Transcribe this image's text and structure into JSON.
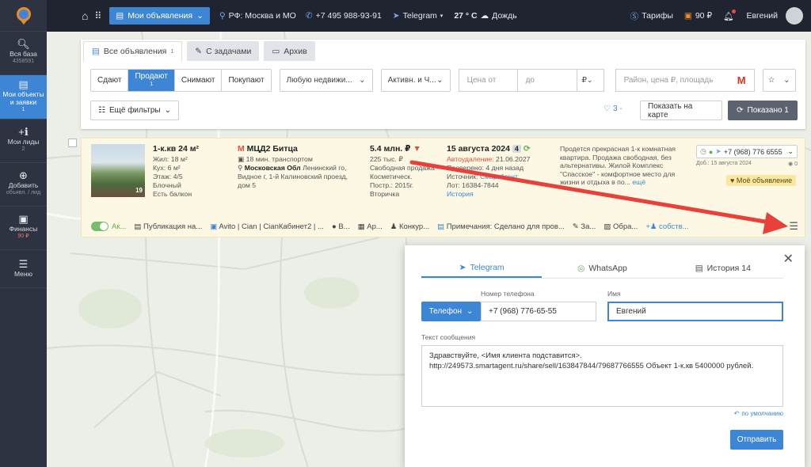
{
  "sidebar": {
    "items": [
      {
        "label": "Вся база",
        "sub": "4358591"
      },
      {
        "label": "Мои объекты и заявки",
        "sub": "1"
      },
      {
        "label": "Мои лиды",
        "sub": "2"
      },
      {
        "label": "Добавить",
        "sub": "объявл. / лид"
      },
      {
        "label": "Финансы",
        "sub": "90 ₽"
      },
      {
        "label": "Меню",
        "sub": ""
      }
    ]
  },
  "topbar": {
    "my_ads": "Мои объявления",
    "region": "РФ: Москва и МО",
    "phone": "+7 495 988-93-91",
    "telegram": "Telegram",
    "weather_temp": "27 ° C",
    "weather_text": "Дождь",
    "tariffs": "Тарифы",
    "balance": "90 ₽",
    "user": "Евгений"
  },
  "filters": {
    "tabs": [
      {
        "label": "Все объявления",
        "count": "1"
      },
      {
        "label": "С задачами",
        "count": ""
      },
      {
        "label": "Архив",
        "count": ""
      }
    ],
    "deal_types": [
      {
        "label": "Сдают",
        "count": ""
      },
      {
        "label": "Продают",
        "count": "1"
      },
      {
        "label": "Снимают",
        "count": ""
      },
      {
        "label": "Покупают",
        "count": ""
      }
    ],
    "property_select": "Любую недвижи...",
    "status_select": "Активн. и Ч...",
    "price_from_placeholder": "Цена от",
    "price_to_placeholder": "до",
    "currency": "₽",
    "search_placeholder": "Район, цена ₽, площадь",
    "more_filters": "Ещё фильтры",
    "favorites_count": "3",
    "show_on_map": "Показать на карте",
    "shown": "Показано 1"
  },
  "listing": {
    "title": "1-к.кв 24 м²",
    "living": "Жил: 18 м²",
    "kitchen": "Кух: 6 м²",
    "floor": "Этаж: 4/5",
    "material": "Блочный",
    "balcony": "Есть балкон",
    "photo_count": "19",
    "metro": "МЦД2 Битца",
    "transport": "18 мин. транспортом",
    "region": "Московская Обл",
    "address": "Ленинский го, Видное г, 1-й Калиновский проезд, дом 5",
    "price": "5.4 млн. ₽",
    "price_per_m": "225 тыс. ₽",
    "sale_type": "Свободная продажа",
    "repair": "Косметическ.",
    "built": "Постр.: 2015г.",
    "market": "Вторичка",
    "date": "15 августа 2024",
    "date_badge": "4",
    "autodelete_label": "Автоудаление:",
    "autodelete_date": "21.06.2027",
    "checked": "Проверено: 4 дня назад",
    "source_label": "Источник:",
    "source": "СмартАгент",
    "lot": "Лот: 16384-7844",
    "history": "История",
    "description": "Продется прекрасная 1-к комнатная квартира. Продажа свободная, без альтернативы. Жилой Комплекс \"Спасское\" - комфортное место для жизни и отдыха в по...",
    "more": "ещё",
    "contact_phone": "+7 (968) 776 6555",
    "added": "Доб.: 15 августа 2024",
    "views": "0",
    "my_ad": "Моё объявление"
  },
  "actions": {
    "active": "Ак...",
    "publication": "Публикация на...",
    "platforms": "Avito | Cian | CianКабинет2 | ...",
    "v": "В...",
    "ar": "Ар...",
    "competitors": "Конкур...",
    "notes": "Примечания: Сделано для пров...",
    "za": "За...",
    "obr": "Обра...",
    "owners": "собств..."
  },
  "dialog": {
    "tabs": [
      {
        "label": "Telegram"
      },
      {
        "label": "WhatsApp"
      },
      {
        "label": "История 14"
      }
    ],
    "phone_label": "Номер телефона",
    "phone_type": "Телефон",
    "phone_value": "+7 (968) 776-65-55",
    "name_label": "Имя",
    "name_value": "Евгений",
    "message_label": "Текст сообщения",
    "message": "Здравствуйте, <Имя клиента подставится>.\nhttp://249573.smartagent.ru/share/sell/163847844/79687766555 Объект 1-к.кв 5400000 рублей.",
    "default_link": "по умолчанию",
    "send": "Отправить"
  },
  "colors": {
    "accent": "#3d86d6",
    "sidebar": "#2d3340",
    "topbar": "#1f2430",
    "card": "#fcf8e4",
    "arrow": "#e8403a"
  }
}
